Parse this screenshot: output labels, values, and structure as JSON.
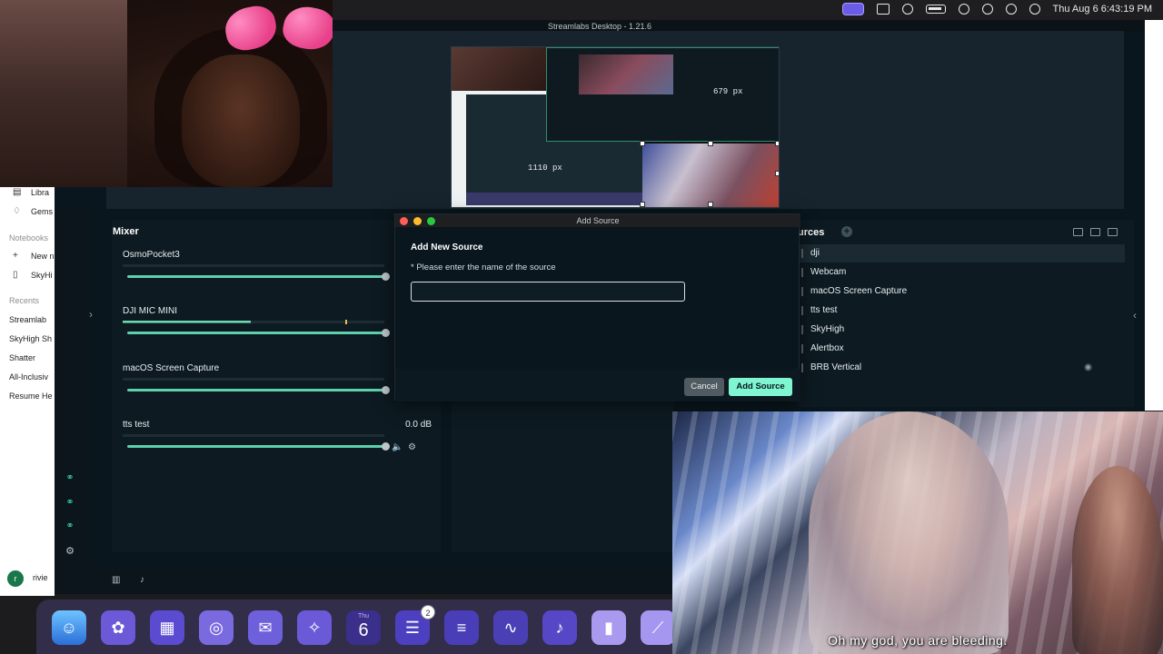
{
  "menubar": {
    "clock": "Thu Aug 6  6:43:19 PM"
  },
  "app": {
    "title": "Streamlabs Desktop - 1.21.6",
    "preview_labels": [
      "679 px",
      "1110 px"
    ]
  },
  "mixer": {
    "title": "Mixer",
    "items": [
      {
        "name": "OsmoPocket3",
        "db": "",
        "level": 0.0
      },
      {
        "name": "DJI MIC MINI",
        "db": "",
        "level": 0.49
      },
      {
        "name": "macOS Screen Capture",
        "db": "",
        "level": 0.0
      },
      {
        "name": "tts test",
        "db": "0.0 dB",
        "level": 0.0
      }
    ]
  },
  "sources": {
    "title": "urces",
    "items": [
      "dji",
      "Webcam",
      "macOS Screen Capture",
      "tts test",
      "SkyHigh",
      "Alertbox",
      "BRB Vertical"
    ]
  },
  "notes": {
    "items_top": [
      "Libra",
      "Gems"
    ],
    "section_notebooks": "Notebooks",
    "notebook_items": [
      "New n",
      "SkyHi"
    ],
    "section_recents": "Recents",
    "recents": [
      "Streamlab",
      "SkyHigh Sh",
      "Shatter",
      "All-Inclusiv",
      "Resume He"
    ],
    "user": "rivie"
  },
  "dialog": {
    "window_title": "Add Source",
    "heading": "Add New Source",
    "label": "* Please enter the name of the source",
    "input_value": "",
    "cancel_label": "Cancel",
    "add_label": "Add Source"
  },
  "dock": {
    "calendar_month": "Thu",
    "calendar_day": "6",
    "reminders_badge": "2"
  },
  "video": {
    "caption": "Oh my god, you are bleeding."
  },
  "colors": {
    "accent": "#80f5d2",
    "panel": "#09161d",
    "meter": "#5dd1ab"
  }
}
